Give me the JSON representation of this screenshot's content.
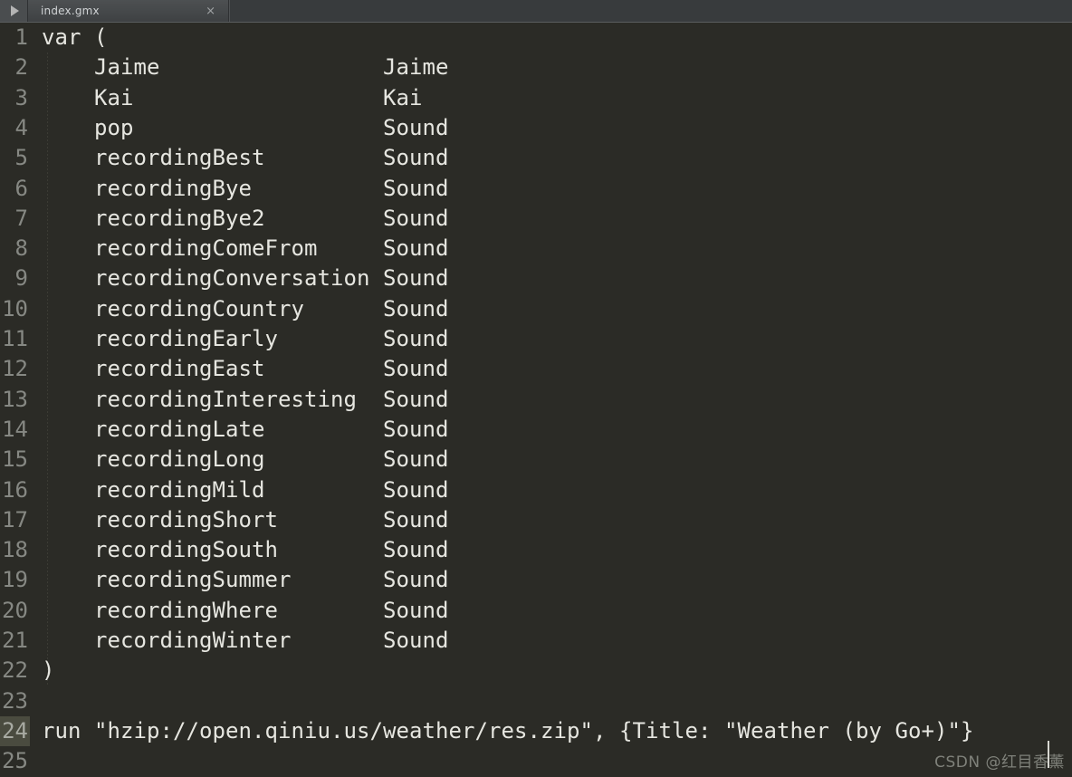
{
  "window": {
    "background_color": "#2b2b26",
    "tabbar_color": "#3c3f41"
  },
  "toolbar": {
    "run_button_label": "",
    "run_icon": "play-triangle-icon"
  },
  "tabs": [
    {
      "label": "index.gmx",
      "close_label": "×",
      "active": true
    }
  ],
  "editor": {
    "language": "gop",
    "active_line": 24,
    "caret_line": 24,
    "first_visible_line": 1,
    "lines": [
      {
        "number": "1",
        "text": "var ("
      },
      {
        "number": "2",
        "text": "    Jaime                 Jaime"
      },
      {
        "number": "3",
        "text": "    Kai                   Kai"
      },
      {
        "number": "4",
        "text": "    pop                   Sound"
      },
      {
        "number": "5",
        "text": "    recordingBest         Sound"
      },
      {
        "number": "6",
        "text": "    recordingBye          Sound"
      },
      {
        "number": "7",
        "text": "    recordingBye2         Sound"
      },
      {
        "number": "8",
        "text": "    recordingComeFrom     Sound"
      },
      {
        "number": "9",
        "text": "    recordingConversation Sound"
      },
      {
        "number": "10",
        "text": "    recordingCountry      Sound"
      },
      {
        "number": "11",
        "text": "    recordingEarly        Sound"
      },
      {
        "number": "12",
        "text": "    recordingEast         Sound"
      },
      {
        "number": "13",
        "text": "    recordingInteresting  Sound"
      },
      {
        "number": "14",
        "text": "    recordingLate         Sound"
      },
      {
        "number": "15",
        "text": "    recordingLong         Sound"
      },
      {
        "number": "16",
        "text": "    recordingMild         Sound"
      },
      {
        "number": "17",
        "text": "    recordingShort        Sound"
      },
      {
        "number": "18",
        "text": "    recordingSouth        Sound"
      },
      {
        "number": "19",
        "text": "    recordingSummer       Sound"
      },
      {
        "number": "20",
        "text": "    recordingWhere        Sound"
      },
      {
        "number": "21",
        "text": "    recordingWinter       Sound"
      },
      {
        "number": "22",
        "text": ")"
      },
      {
        "number": "23",
        "text": ""
      },
      {
        "number": "24",
        "text": "run \"hzip://open.qiniu.us/weather/res.zip\", {Title: \"Weather (by Go+)\"}"
      },
      {
        "number": "25",
        "text": ""
      }
    ]
  },
  "watermark": {
    "text": "CSDN @红目香薰"
  }
}
